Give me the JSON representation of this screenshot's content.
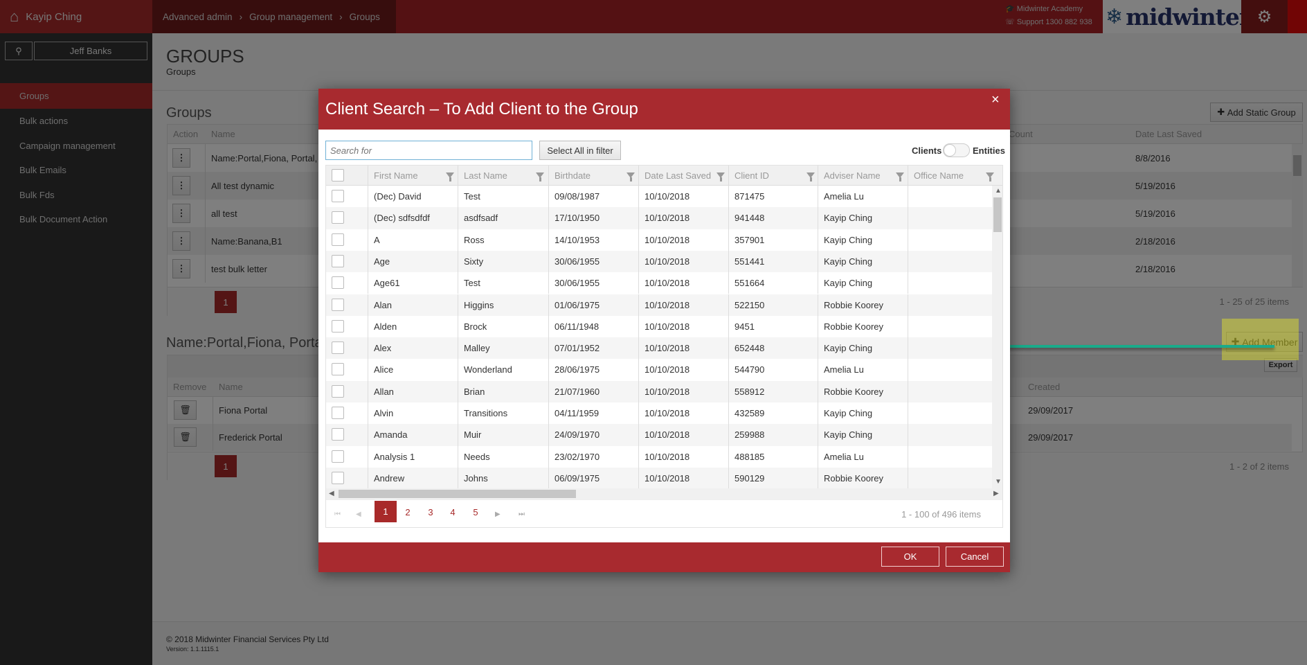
{
  "header": {
    "user": "Kayip Ching",
    "breadcrumb": [
      "Advanced admin",
      "Group management",
      "Groups"
    ],
    "academy": "Midwinter Academy",
    "support": "Support 1300 882 938",
    "logo": "midwinter",
    "icons": [
      "home-icon",
      "graduation-cap-icon",
      "phone-icon",
      "snowflake-icon",
      "gear-icon",
      "user-icon"
    ]
  },
  "sidebar": {
    "search_value": "Jeff Banks",
    "items": [
      {
        "label": "Groups",
        "active": true
      },
      {
        "label": "Bulk actions"
      },
      {
        "label": "Campaign management"
      },
      {
        "label": "Bulk Emails"
      },
      {
        "label": "Bulk Fds"
      },
      {
        "label": "Bulk Document Action"
      }
    ]
  },
  "page": {
    "title": "GROUPS",
    "subtitle": "Groups",
    "section_title": "Groups",
    "add_static_group": "Add Static Group"
  },
  "groups_grid": {
    "columns": [
      "Action",
      "Name",
      "Count",
      "Date Last Saved"
    ],
    "rows": [
      [
        "Name:Portal,Fiona, Portal,",
        "8/8/2016"
      ],
      [
        "All test dynamic",
        "5/19/2016"
      ],
      [
        "all test",
        "5/19/2016"
      ],
      [
        "Name:Banana,B1",
        "2/18/2016"
      ],
      [
        "test bulk letter",
        "2/18/2016"
      ]
    ],
    "page": "1",
    "summary": "1 - 25 of 25 items"
  },
  "members": {
    "title": "Name:Portal,Fiona, Portal",
    "add_member": "Add Member",
    "export": "Export",
    "columns": [
      "Remove",
      "Name",
      "Created"
    ],
    "rows": [
      [
        "Fiona Portal",
        "29/09/2017"
      ],
      [
        "Frederick Portal",
        "29/09/2017"
      ]
    ],
    "page": "1",
    "summary": "1 - 2 of 2 items"
  },
  "footer": {
    "copyright": "© 2018 Midwinter Financial Services Pty Ltd",
    "version": "Version: 1.1.1115.1"
  },
  "modal": {
    "title": "Client Search – To Add Client to the Group",
    "close": "×",
    "search_placeholder": "Search for",
    "select_all": "Select All in filter",
    "toggle_left": "Clients",
    "toggle_right": "Entities",
    "toggle_on": false,
    "columns": [
      "First Name",
      "Last Name",
      "Birthdate",
      "Date Last Saved",
      "Client ID",
      "Adviser Name",
      "Office Name"
    ],
    "rows": [
      [
        "(Dec) David",
        "Test",
        "09/08/1987",
        "10/10/2018",
        "871475",
        "Amelia Lu",
        ""
      ],
      [
        "(Dec) sdfsdfdf",
        "asdfsadf",
        "17/10/1950",
        "10/10/2018",
        "941448",
        "Kayip Ching",
        ""
      ],
      [
        "A",
        "Ross",
        "14/10/1953",
        "10/10/2018",
        "357901",
        "Kayip Ching",
        ""
      ],
      [
        "Age",
        "Sixty",
        "30/06/1955",
        "10/10/2018",
        "551441",
        "Kayip Ching",
        ""
      ],
      [
        "Age61",
        "Test",
        "30/06/1955",
        "10/10/2018",
        "551664",
        "Kayip Ching",
        ""
      ],
      [
        "Alan",
        "Higgins",
        "01/06/1975",
        "10/10/2018",
        "522150",
        "Robbie Koorey",
        ""
      ],
      [
        "Alden",
        "Brock",
        "06/11/1948",
        "10/10/2018",
        "9451",
        "Robbie Koorey",
        ""
      ],
      [
        "Alex",
        "Malley",
        "07/01/1952",
        "10/10/2018",
        "652448",
        "Kayip Ching",
        ""
      ],
      [
        "Alice",
        "Wonderland",
        "28/06/1975",
        "10/10/2018",
        "544790",
        "Amelia Lu",
        ""
      ],
      [
        "Allan",
        "Brian",
        "21/07/1960",
        "10/10/2018",
        "558912",
        "Robbie Koorey",
        ""
      ],
      [
        "Alvin",
        "Transitions",
        "04/11/1959",
        "10/10/2018",
        "432589",
        "Kayip Ching",
        ""
      ],
      [
        "Amanda",
        "Muir",
        "24/09/1970",
        "10/10/2018",
        "259988",
        "Kayip Ching",
        ""
      ],
      [
        "Analysis 1",
        "Needs",
        "23/02/1970",
        "10/10/2018",
        "488185",
        "Amelia Lu",
        ""
      ],
      [
        "Andrew",
        "Johns",
        "06/09/1975",
        "10/10/2018",
        "590129",
        "Robbie Koorey",
        ""
      ]
    ],
    "pages": [
      "1",
      "2",
      "3",
      "4",
      "5"
    ],
    "current_page": "1",
    "summary": "1 - 100 of 496 items",
    "ok": "OK",
    "cancel": "Cancel"
  },
  "colors": {
    "brand_red": "#a82a2f",
    "highlight": "#e6e62a",
    "annotation_line": "#1aab8a"
  }
}
